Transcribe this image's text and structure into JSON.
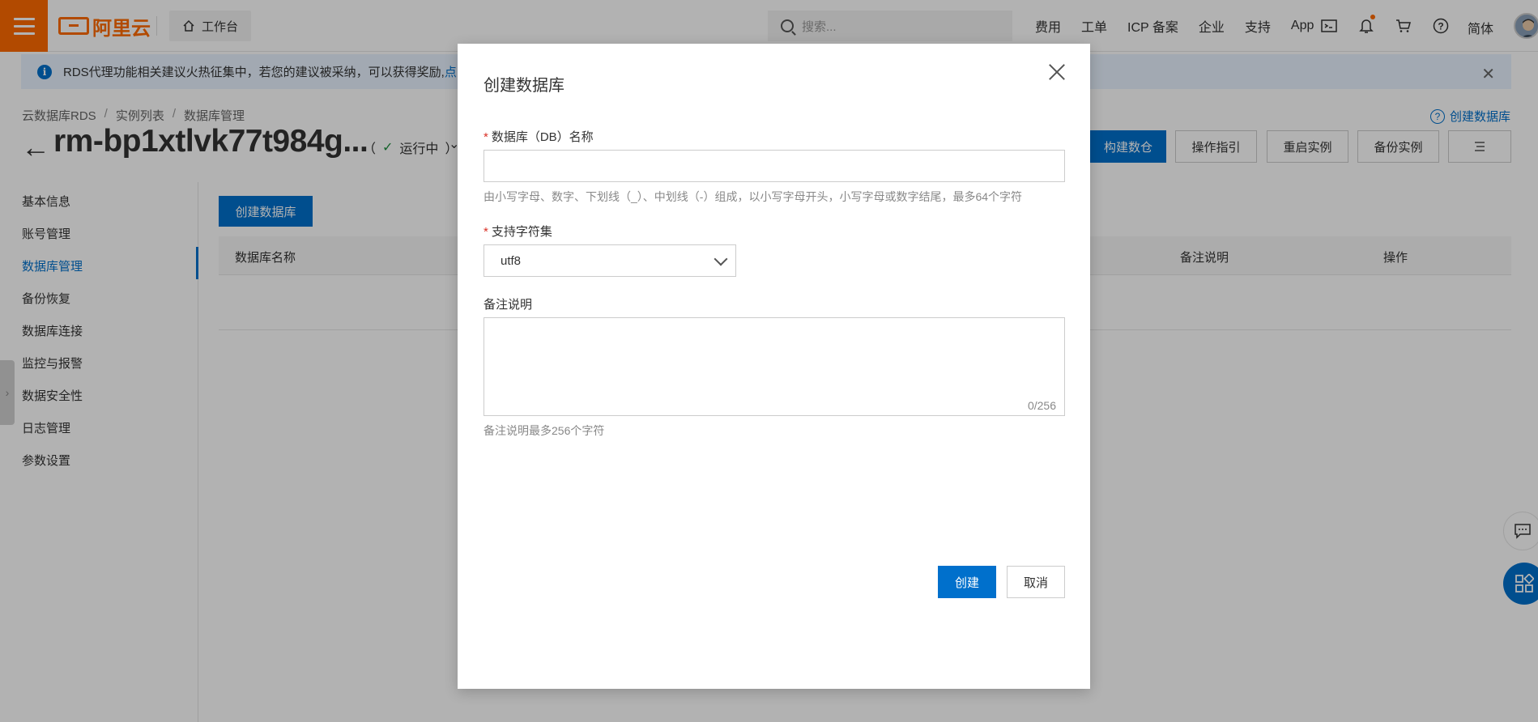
{
  "topbar": {
    "logo_text": "阿里云",
    "workbench_label": "工作台",
    "search_placeholder": "搜索...",
    "nav_links": [
      "费用",
      "工单",
      "ICP 备案",
      "企业",
      "支持",
      "App"
    ],
    "lang_label": "简体"
  },
  "notice": {
    "text": "RDS代理功能相关建议火热征集中，若您的建议被采纳，可以获得奖励, ",
    "link_text": "点"
  },
  "breadcrumb": [
    "云数据库RDS",
    "实例列表",
    "数据库管理"
  ],
  "header": {
    "instance_name": "rm-bp1xtlvk77t984g...",
    "status_open": "（",
    "status_text": "运行中",
    "status_close": "）",
    "help_link": "创建数据库",
    "buttons": [
      "构建数仓",
      "操作指引",
      "重启实例",
      "备份实例"
    ]
  },
  "sidebar": {
    "items": [
      "基本信息",
      "账号管理",
      "数据库管理",
      "备份恢复",
      "数据库连接",
      "监控与报警",
      "数据安全性",
      "日志管理",
      "参数设置"
    ],
    "active_index": 2
  },
  "main": {
    "create_button": "创建数据库",
    "columns": [
      "数据库名称",
      "备注说明",
      "操作"
    ]
  },
  "modal": {
    "title": "创建数据库",
    "db_name_label": "数据库（DB）名称",
    "db_name_value": "",
    "db_name_help": "由小写字母、数字、下划线（_）、中划线（-）组成，以小写字母开头，小写字母或数字结尾，最多64个字符",
    "charset_label": "支持字符集",
    "charset_value": "utf8",
    "remark_label": "备注说明",
    "remark_value": "",
    "remark_counter": "0/256",
    "remark_help": "备注说明最多256个字符",
    "create_label": "创建",
    "cancel_label": "取消"
  },
  "colors": {
    "brand_orange": "#ff6a00",
    "primary_blue": "#0070cc",
    "required_red": "#d93026",
    "success_green": "#1e8e3e"
  }
}
